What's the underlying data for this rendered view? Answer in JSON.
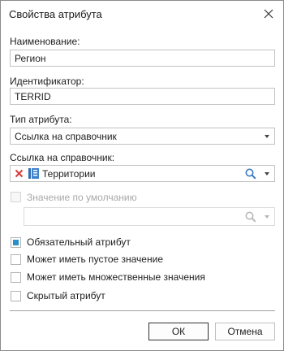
{
  "window": {
    "title": "Свойства атрибута",
    "close_icon": "close-icon"
  },
  "name": {
    "label": "Наименование:",
    "value": "Регион"
  },
  "identifier": {
    "label": "Идентификатор:",
    "value": "TERRID"
  },
  "attr_type": {
    "label": "Тип атрибута:",
    "value": "Ссылка на справочник"
  },
  "ref": {
    "label": "Ссылка на справочник:",
    "value": "Территории"
  },
  "default_value": {
    "label": "Значение по умолчанию",
    "checked": false,
    "enabled": false,
    "value": ""
  },
  "flags": [
    {
      "label": "Обязательный атрибут",
      "checked": true
    },
    {
      "label": "Может иметь пустое значение",
      "checked": false
    },
    {
      "label": "Может иметь множественные значения",
      "checked": false
    },
    {
      "label": "Скрытый атрибут",
      "checked": false
    }
  ],
  "buttons": {
    "ok": "ОК",
    "cancel": "Отмена"
  },
  "colors": {
    "accent": "#2b8fc9",
    "clear_red": "#d83b3b",
    "dir_blue": "#2f6db5",
    "search_blue": "#3a78c2"
  }
}
